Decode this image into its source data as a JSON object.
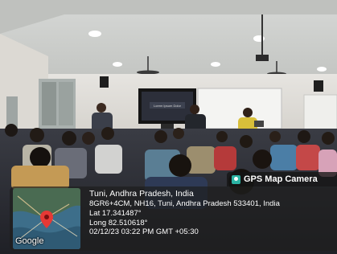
{
  "watermark": {
    "app_name": "GPS Map Camera",
    "location_title": "Tuni, Andhra Pradesh, India",
    "address": "8GR6+4CM, NH16, Tuni, Andhra Pradesh 533401, India",
    "latitude": "Lat 17.341487°",
    "longitude": "Long 82.510618°",
    "datetime": "02/12/23 03:22 PM GMT +05:30",
    "map_label": "Google"
  },
  "screen": {
    "slide_text": "Lorem Ipsum Dolor"
  },
  "colors": {
    "overlay": "#1e1e1e",
    "logo": "#2bb3a3",
    "map_water": "#3d6e8a",
    "pin": "#e53935"
  }
}
